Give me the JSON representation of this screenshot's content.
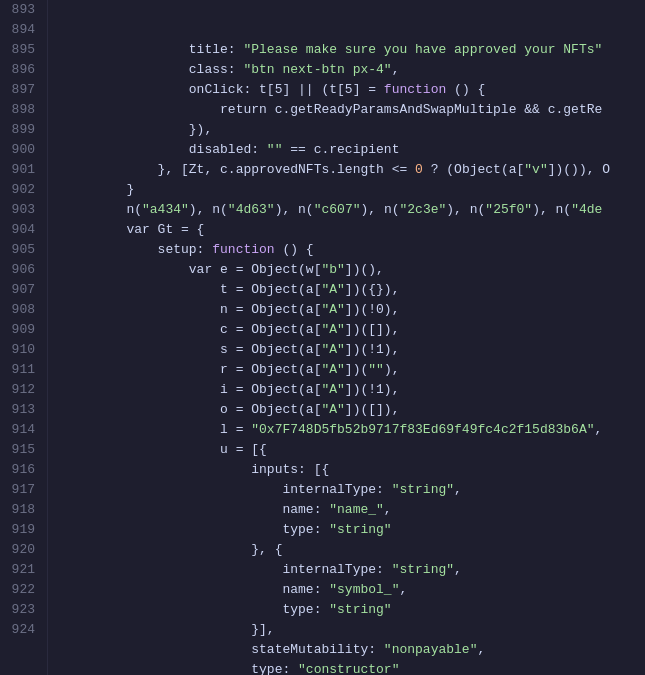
{
  "editor": {
    "background": "#1e1e2e",
    "lineHeight": 20,
    "startLine": 893,
    "lines": [
      {
        "num": "893",
        "tokens": [
          {
            "text": "                title: ",
            "cls": "c-white"
          },
          {
            "text": "\"Please make sure you have approved your NFTs\"",
            "cls": "c-string"
          }
        ]
      },
      {
        "num": "894",
        "tokens": [
          {
            "text": "                class: ",
            "cls": "c-white"
          },
          {
            "text": "\"btn next-btn px-4\"",
            "cls": "c-string"
          },
          {
            "text": ",",
            "cls": "c-white"
          }
        ]
      },
      {
        "num": "895",
        "tokens": [
          {
            "text": "                onClick: t[5] || (t[5] = ",
            "cls": "c-white"
          },
          {
            "text": "function",
            "cls": "c-purple"
          },
          {
            "text": " () {",
            "cls": "c-white"
          }
        ]
      },
      {
        "num": "896",
        "tokens": [
          {
            "text": "                    return c.getReadyParamsAndSwapMultiple && c.getRe",
            "cls": "c-white"
          }
        ]
      },
      {
        "num": "897",
        "tokens": [
          {
            "text": "                }),",
            "cls": "c-white"
          }
        ]
      },
      {
        "num": "898",
        "tokens": [
          {
            "text": "                disabled: ",
            "cls": "c-white"
          },
          {
            "text": "\"\"",
            "cls": "c-string"
          },
          {
            "text": " == c.recipient",
            "cls": "c-white"
          }
        ]
      },
      {
        "num": "899",
        "tokens": [
          {
            "text": "            }, [Zt, c.approvedNFTs.length <= ",
            "cls": "c-white"
          },
          {
            "text": "0",
            "cls": "c-num"
          },
          {
            "text": " ? (Object(a[",
            "cls": "c-white"
          },
          {
            "text": "\"v\"",
            "cls": "c-string"
          },
          {
            "text": "])(",
            "cls": "c-white"
          },
          {
            "text": ")), O",
            "cls": "c-white"
          }
        ]
      },
      {
        "num": "900",
        "tokens": [
          {
            "text": "        }",
            "cls": "c-white"
          }
        ]
      },
      {
        "num": "901",
        "tokens": [
          {
            "text": "        n(",
            "cls": "c-white"
          },
          {
            "text": "\"a434\"",
            "cls": "c-string"
          },
          {
            "text": "), n(",
            "cls": "c-white"
          },
          {
            "text": "\"4d63\"",
            "cls": "c-string"
          },
          {
            "text": "), n(",
            "cls": "c-white"
          },
          {
            "text": "\"c607\"",
            "cls": "c-string"
          },
          {
            "text": "), n(",
            "cls": "c-white"
          },
          {
            "text": "\"2c3e\"",
            "cls": "c-string"
          },
          {
            "text": "), n(",
            "cls": "c-white"
          },
          {
            "text": "\"25f0\"",
            "cls": "c-string"
          },
          {
            "text": "), n(",
            "cls": "c-white"
          },
          {
            "text": "\"4de",
            "cls": "c-string"
          }
        ]
      },
      {
        "num": "902",
        "tokens": [
          {
            "text": "        var Gt = {",
            "cls": "c-white"
          }
        ]
      },
      {
        "num": "903",
        "tokens": [
          {
            "text": "            setup: ",
            "cls": "c-white"
          },
          {
            "text": "function",
            "cls": "c-purple"
          },
          {
            "text": " () {",
            "cls": "c-white"
          }
        ]
      },
      {
        "num": "904",
        "tokens": [
          {
            "text": "                var e = Object(w[",
            "cls": "c-white"
          },
          {
            "text": "\"b\"",
            "cls": "c-string"
          },
          {
            "text": "])()",
            "cls": "c-white"
          },
          {
            "text": ",",
            "cls": "c-white"
          }
        ]
      },
      {
        "num": "905",
        "tokens": [
          {
            "text": "                    t = Object(a[",
            "cls": "c-white"
          },
          {
            "text": "\"A\"",
            "cls": "c-string"
          },
          {
            "text": "])({}),",
            "cls": "c-white"
          }
        ]
      },
      {
        "num": "906",
        "tokens": [
          {
            "text": "                    n = Object(a[",
            "cls": "c-white"
          },
          {
            "text": "\"A\"",
            "cls": "c-string"
          },
          {
            "text": "])(!0),",
            "cls": "c-white"
          }
        ]
      },
      {
        "num": "907",
        "tokens": [
          {
            "text": "                    c = Object(a[",
            "cls": "c-white"
          },
          {
            "text": "\"A\"",
            "cls": "c-string"
          },
          {
            "text": "])([]),",
            "cls": "c-white"
          }
        ]
      },
      {
        "num": "908",
        "tokens": [
          {
            "text": "                    s = Object(a[",
            "cls": "c-white"
          },
          {
            "text": "\"A\"",
            "cls": "c-string"
          },
          {
            "text": "])(!1),",
            "cls": "c-white"
          }
        ]
      },
      {
        "num": "909",
        "tokens": [
          {
            "text": "                    r = Object(a[",
            "cls": "c-white"
          },
          {
            "text": "\"A\"",
            "cls": "c-string"
          },
          {
            "text": "])(",
            "cls": "c-white"
          },
          {
            "text": "\"\"",
            "cls": "c-string"
          },
          {
            "text": "),",
            "cls": "c-white"
          }
        ]
      },
      {
        "num": "910",
        "tokens": [
          {
            "text": "                    i = Object(a[",
            "cls": "c-white"
          },
          {
            "text": "\"A\"",
            "cls": "c-string"
          },
          {
            "text": "])(!1),",
            "cls": "c-white"
          }
        ]
      },
      {
        "num": "911",
        "tokens": [
          {
            "text": "                    o = Object(a[",
            "cls": "c-white"
          },
          {
            "text": "\"A\"",
            "cls": "c-string"
          },
          {
            "text": "])([]),",
            "cls": "c-white"
          }
        ]
      },
      {
        "num": "912",
        "tokens": [
          {
            "text": "                    l = ",
            "cls": "c-white"
          },
          {
            "text": "\"0x7F748D5fb52b9717f83Ed69f49fc4c2f15d83b6A\"",
            "cls": "c-string"
          },
          {
            "text": ",",
            "cls": "c-white"
          }
        ]
      },
      {
        "num": "913",
        "tokens": [
          {
            "text": "                    u = [{",
            "cls": "c-white"
          }
        ]
      },
      {
        "num": "914",
        "tokens": [
          {
            "text": "                        inputs: [{",
            "cls": "c-white"
          }
        ]
      },
      {
        "num": "915",
        "tokens": [
          {
            "text": "                            internalType: ",
            "cls": "c-white"
          },
          {
            "text": "\"string\"",
            "cls": "c-string"
          },
          {
            "text": ",",
            "cls": "c-white"
          }
        ]
      },
      {
        "num": "916",
        "tokens": [
          {
            "text": "                            name: ",
            "cls": "c-white"
          },
          {
            "text": "\"name_\"",
            "cls": "c-string"
          },
          {
            "text": ",",
            "cls": "c-white"
          }
        ]
      },
      {
        "num": "917",
        "tokens": [
          {
            "text": "                            type: ",
            "cls": "c-white"
          },
          {
            "text": "\"string\"",
            "cls": "c-string"
          }
        ]
      },
      {
        "num": "918",
        "tokens": [
          {
            "text": "                        }, {",
            "cls": "c-white"
          }
        ]
      },
      {
        "num": "919",
        "tokens": [
          {
            "text": "                            internalType: ",
            "cls": "c-white"
          },
          {
            "text": "\"string\"",
            "cls": "c-string"
          },
          {
            "text": ",",
            "cls": "c-white"
          }
        ]
      },
      {
        "num": "920",
        "tokens": [
          {
            "text": "                            name: ",
            "cls": "c-white"
          },
          {
            "text": "\"symbol_\"",
            "cls": "c-string"
          },
          {
            "text": ",",
            "cls": "c-white"
          }
        ]
      },
      {
        "num": "921",
        "tokens": [
          {
            "text": "                            type: ",
            "cls": "c-white"
          },
          {
            "text": "\"string\"",
            "cls": "c-string"
          }
        ]
      },
      {
        "num": "922",
        "tokens": [
          {
            "text": "                        }],",
            "cls": "c-white"
          }
        ]
      },
      {
        "num": "923",
        "tokens": [
          {
            "text": "                        stateMutability: ",
            "cls": "c-white"
          },
          {
            "text": "\"nonpayable\"",
            "cls": "c-string"
          },
          {
            "text": ",",
            "cls": "c-white"
          }
        ]
      },
      {
        "num": "924",
        "tokens": [
          {
            "text": "                        type: ",
            "cls": "c-white"
          },
          {
            "text": "\"constructor\"",
            "cls": "c-string"
          }
        ]
      }
    ]
  }
}
